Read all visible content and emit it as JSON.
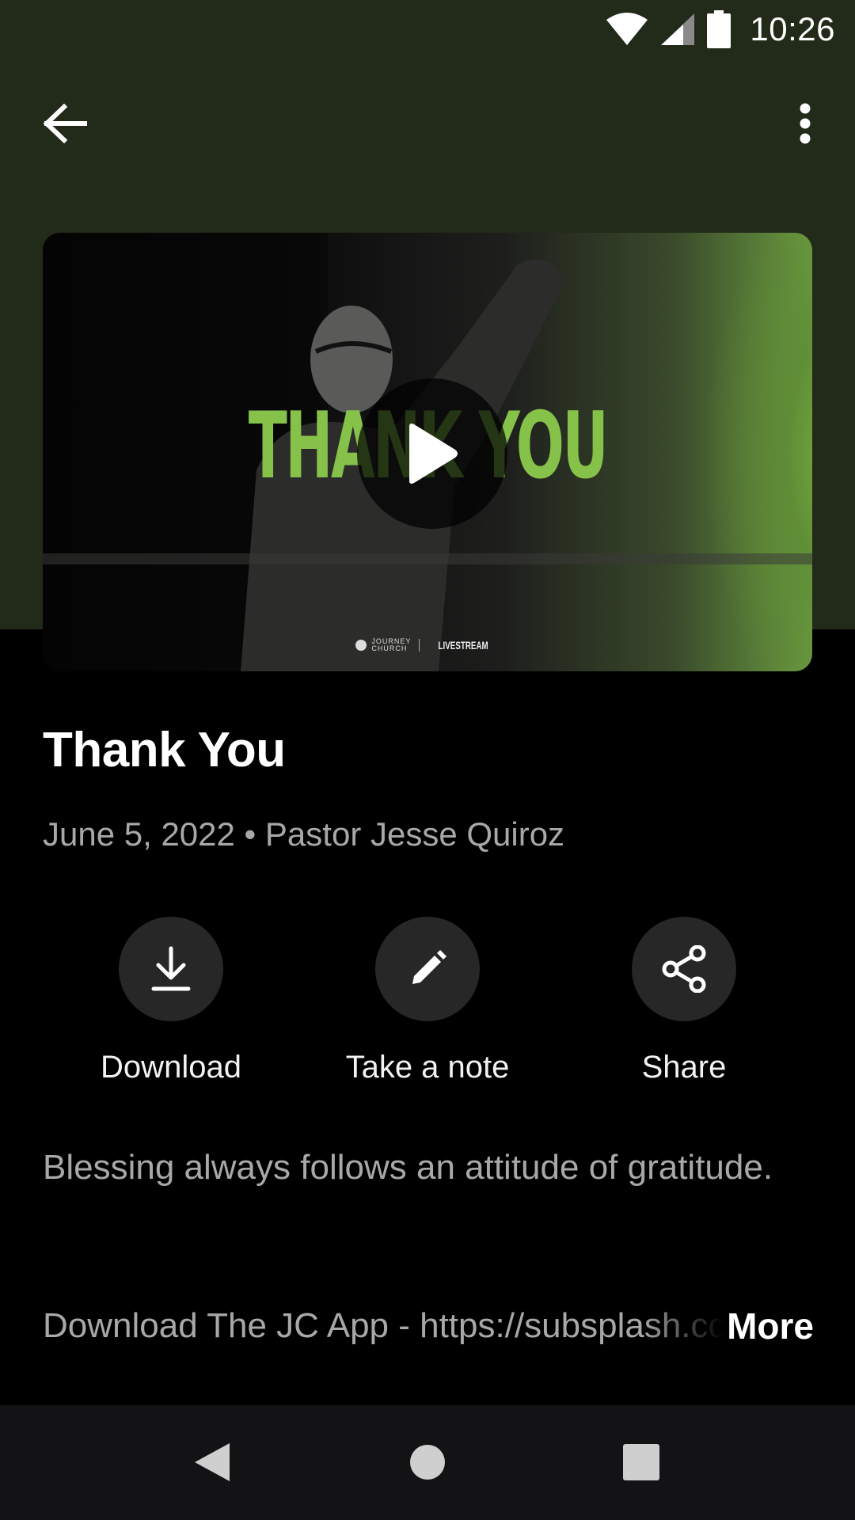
{
  "status_bar": {
    "time": "10:26",
    "icons": [
      "wifi-icon",
      "cell-signal-icon",
      "battery-icon"
    ]
  },
  "app_bar": {
    "back_icon": "arrow-back-icon",
    "overflow_icon": "more-vert-icon"
  },
  "media": {
    "thumbnail_title": "THANK YOU",
    "watermark_brand_top": "JOURNEY",
    "watermark_brand_bottom": "CHURCH",
    "watermark_tag": "LIVESTREAM",
    "play_icon": "play-icon"
  },
  "content": {
    "title": "Thank You",
    "meta": "June 5, 2022 • Pastor Jesse Quiroz",
    "description": "Blessing always follows an attitude of gratitude.",
    "link_text": "Download The JC App - https://subsplash.com/journeychurch/app",
    "more_label": "More"
  },
  "actions": [
    {
      "label": "Download",
      "icon": "download-icon"
    },
    {
      "label": "Take a note",
      "icon": "pencil-icon"
    },
    {
      "label": "Share",
      "icon": "share-icon"
    }
  ],
  "nav_bar": {
    "icons": [
      "nav-back-icon",
      "nav-home-icon",
      "nav-recents-icon"
    ]
  },
  "colors": {
    "header_bg": "#222a19",
    "accent_green": "#86c24a",
    "background": "#000000",
    "action_circle": "#272727",
    "secondary_text": "#a8a8a8",
    "nav_bar": "#131315"
  }
}
